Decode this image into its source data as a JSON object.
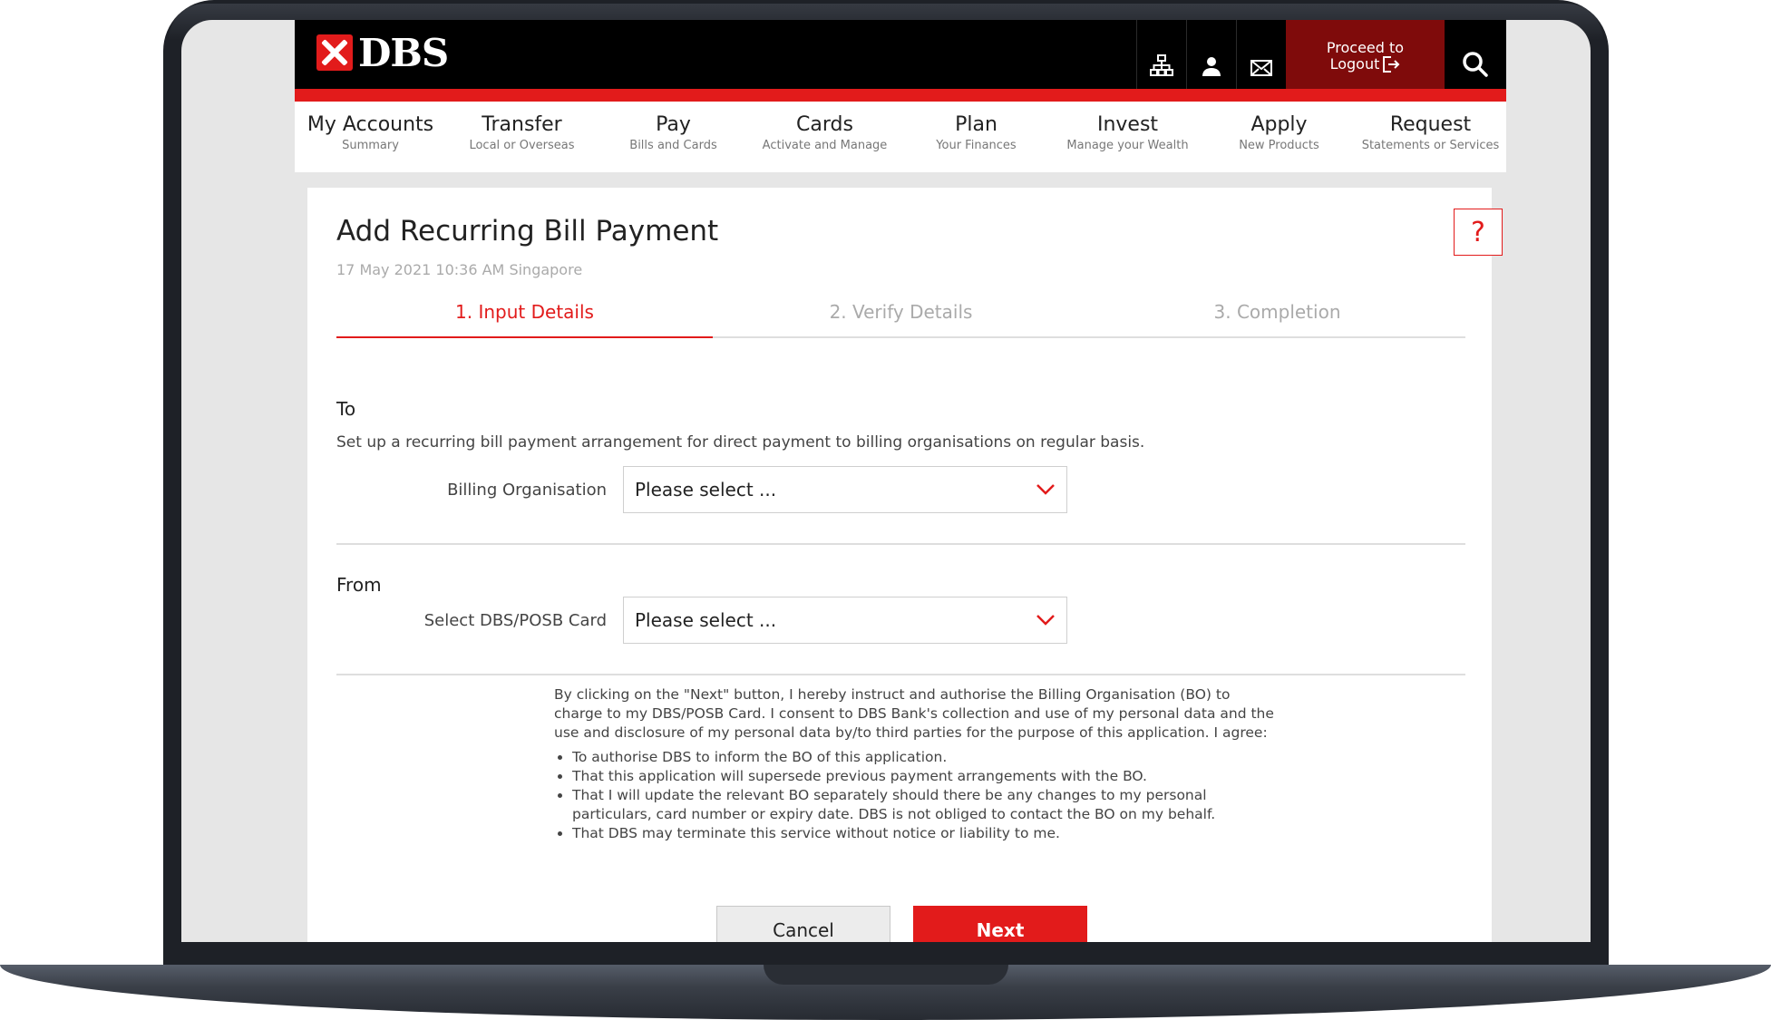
{
  "brand": {
    "name": "DBS",
    "accent": "#e21b1b"
  },
  "header": {
    "icons": [
      "sitemap-icon",
      "user-icon",
      "mail-icon"
    ],
    "logout_line1": "Proceed to",
    "logout_line2": "Logout",
    "search_icon": "search-icon"
  },
  "nav": [
    {
      "title": "My Accounts",
      "sub": "Summary"
    },
    {
      "title": "Transfer",
      "sub": "Local or Overseas"
    },
    {
      "title": "Pay",
      "sub": "Bills and Cards"
    },
    {
      "title": "Cards",
      "sub": "Activate and Manage"
    },
    {
      "title": "Plan",
      "sub": "Your Finances"
    },
    {
      "title": "Invest",
      "sub": "Manage your Wealth"
    },
    {
      "title": "Apply",
      "sub": "New Products"
    },
    {
      "title": "Request",
      "sub": "Statements or Services"
    }
  ],
  "page": {
    "title": "Add Recurring Bill Payment",
    "timestamp": "17 May 2021 10:36 AM Singapore",
    "help": "?"
  },
  "steps": [
    {
      "label": "1. Input Details",
      "active": true
    },
    {
      "label": "2. Verify Details",
      "active": false
    },
    {
      "label": "3. Completion",
      "active": false
    }
  ],
  "to_section": {
    "heading": "To",
    "description": "Set up a recurring bill payment arrangement for direct payment to billing organisations on regular basis.",
    "billing_label": "Billing Organisation",
    "billing_value": "Please select ..."
  },
  "from_section": {
    "heading": "From",
    "card_label": "Select DBS/POSB Card",
    "card_value": "Please select ..."
  },
  "terms": {
    "intro": "By clicking on the \"Next\" button, I hereby instruct and authorise the Billing Organisation (BO) to charge to my DBS/POSB Card. I consent to DBS Bank's collection and use of my personal data and the use and disclosure of my personal data by/to third parties for the purpose of this application. I agree:",
    "items": [
      "To authorise DBS to inform the BO of this application.",
      "That this application will supersede previous payment arrangements with the BO.",
      "That I will update the relevant BO separately should there be any changes to my personal particulars, card number or expiry date. DBS is not obliged to contact the BO on my behalf.",
      "That DBS may terminate this service without notice or liability to me."
    ]
  },
  "actions": {
    "cancel": "Cancel",
    "next": "Next"
  }
}
